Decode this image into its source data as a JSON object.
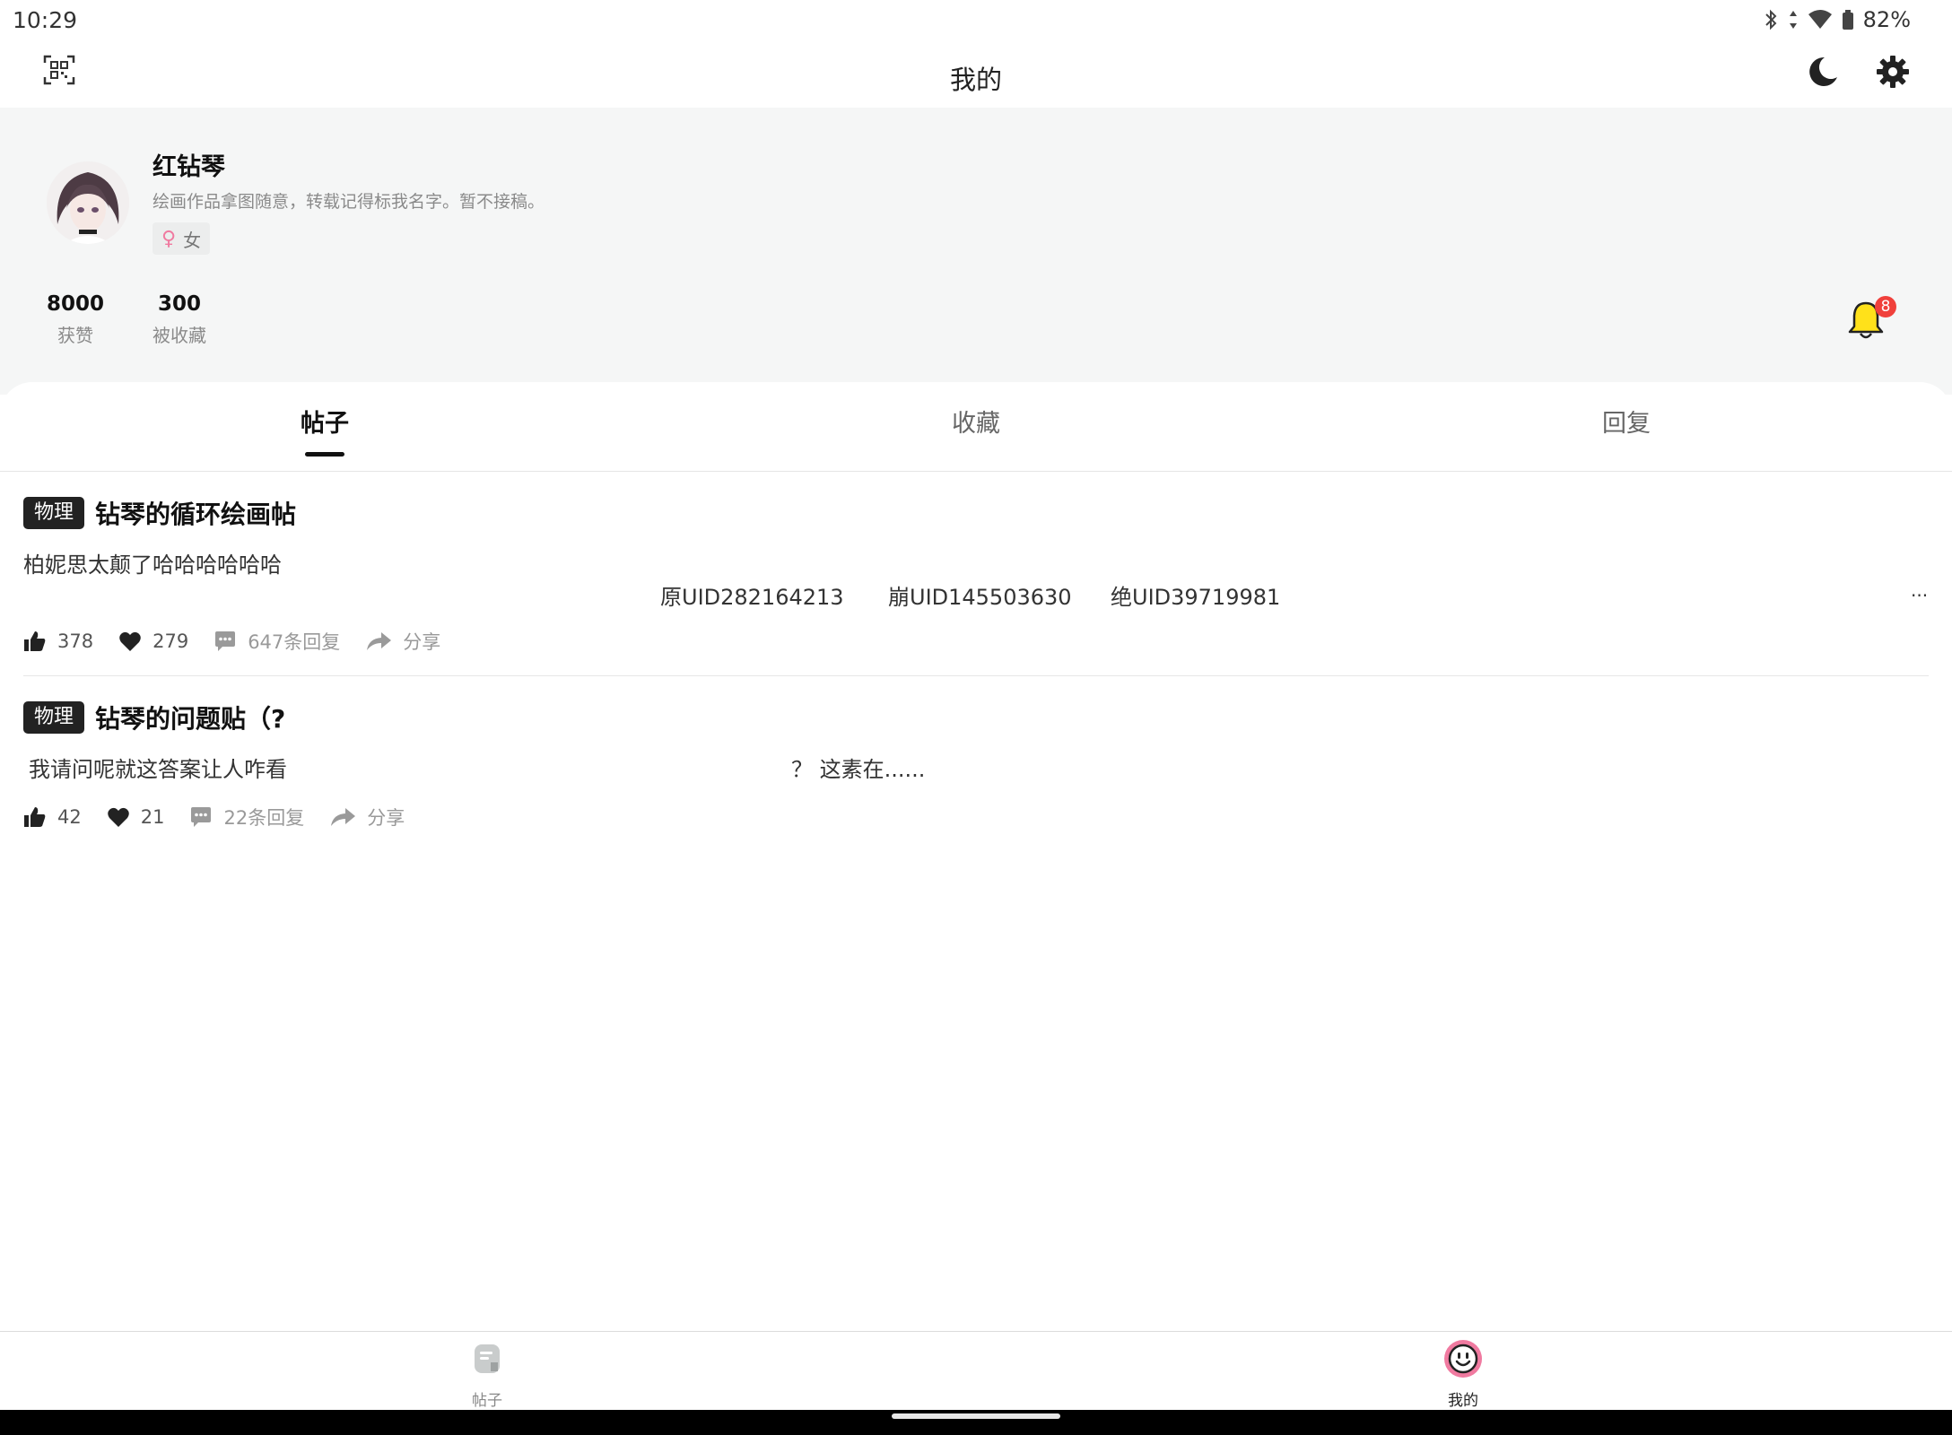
{
  "status_bar": {
    "time": "10:29",
    "battery": "82%",
    "icons": [
      "bluetooth-icon",
      "data-arrows-icon",
      "wifi-icon",
      "battery-icon"
    ]
  },
  "header": {
    "title": "我的",
    "left_icon": "qr-scan-icon",
    "right_icons": [
      "moon-icon",
      "gear-icon"
    ]
  },
  "profile": {
    "name": "红钻琴",
    "bio": "绘画作品拿图随意，转载记得标我名字。暂不接稿。",
    "gender": {
      "symbol": "♀",
      "label": "女",
      "color": "#f07aa0"
    },
    "stats": [
      {
        "value": "8000",
        "label": "获赞"
      },
      {
        "value": "300",
        "label": "被收藏"
      }
    ],
    "notifications": {
      "count": "8",
      "bell_color": "#ffe11a",
      "badge_color": "#f0403b"
    }
  },
  "tabs": [
    {
      "label": "帖子",
      "active": true
    },
    {
      "label": "收藏",
      "active": false
    },
    {
      "label": "回复",
      "active": false
    }
  ],
  "posts": [
    {
      "tag": "物理",
      "title": "钻琴的循环绘画帖",
      "body": "柏妮思太颠了哈哈哈哈哈哈",
      "uids": [
        "原UID282164213",
        "崩UID145503630",
        "绝UID39719981"
      ],
      "more": "...",
      "likes": "378",
      "favorites": "279",
      "replies": "647条回复",
      "share": "分享"
    },
    {
      "tag": "物理",
      "title": "钻琴的问题贴（?",
      "body": "我请问呢就这答案让人咋看",
      "body_tail": "？ 这素在......",
      "likes": "42",
      "favorites": "21",
      "replies": "22条回复",
      "share": "分享"
    }
  ],
  "bottom_nav": [
    {
      "label": "帖子",
      "active": false
    },
    {
      "label": "我的",
      "active": true
    }
  ],
  "colors": {
    "accent_pink": "#f07aa0",
    "profile_bg": "#f5f6f6",
    "tag_bg": "#222222"
  }
}
